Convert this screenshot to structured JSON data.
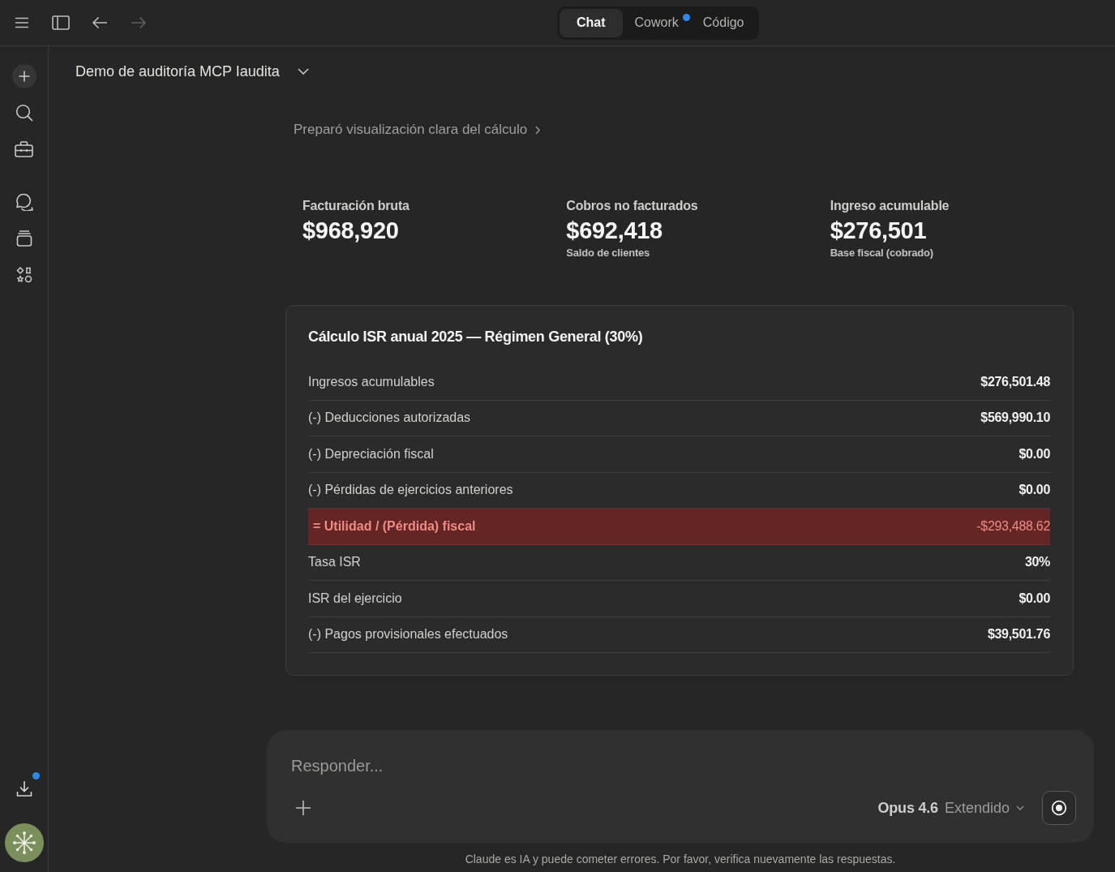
{
  "top_bar": {
    "nav_buttons": [
      {
        "kind": "back",
        "disabled": false
      },
      {
        "kind": "forward",
        "disabled": true
      }
    ],
    "tabs": [
      {
        "label": "Chat",
        "selected": true,
        "notification_dot": false
      },
      {
        "label": "Cowork",
        "selected": false,
        "notification_dot": true
      },
      {
        "label": "Código",
        "selected": false,
        "notification_dot": false
      }
    ]
  },
  "sidebar": {
    "download": {
      "notification_dot": true
    }
  },
  "conversation": {
    "title": "Demo de auditoría MCP Iaudita",
    "step_summary": "Preparó visualización clara del cálculo"
  },
  "stats": [
    {
      "label": "Facturación bruta",
      "value": "$968,920"
    },
    {
      "label": "Cobros no facturados",
      "value": "$692,418",
      "note": "Saldo de clientes"
    },
    {
      "label": "Ingreso acumulable",
      "value": "$276,501",
      "note": "Base fiscal (cobrado)"
    }
  ],
  "card": {
    "title": "Cálculo ISR anual 2025 — Régimen General (30%)",
    "rows": [
      {
        "label": "Ingresos acumulables",
        "value": "$276,501.48",
        "highlighted": false
      },
      {
        "label": "(-) Deducciones autorizadas",
        "value": "$569,990.10",
        "highlighted": false
      },
      {
        "label": "(-) Depreciación fiscal",
        "value": "$0.00",
        "highlighted": false
      },
      {
        "label": "(-) Pérdidas de ejercicios anteriores",
        "value": "$0.00",
        "highlighted": false
      },
      {
        "label": "= Utilidad / (Pérdida) fiscal",
        "value": "-$293,488.62",
        "highlighted": true
      },
      {
        "label": "Tasa ISR",
        "value": "30%",
        "highlighted": false
      },
      {
        "label": "ISR del ejercicio",
        "value": "$0.00",
        "highlighted": false
      },
      {
        "label": "(-) Pagos provisionales efectuados",
        "value": "$39,501.76",
        "highlighted": false
      }
    ]
  },
  "composer": {
    "placeholder": "Responder...",
    "model": "Opus 4.6",
    "mode": "Extendido"
  },
  "disclaimer": "Claude es IA y puede cometer errores. Por favor, verifica nuevamente las respuestas."
}
